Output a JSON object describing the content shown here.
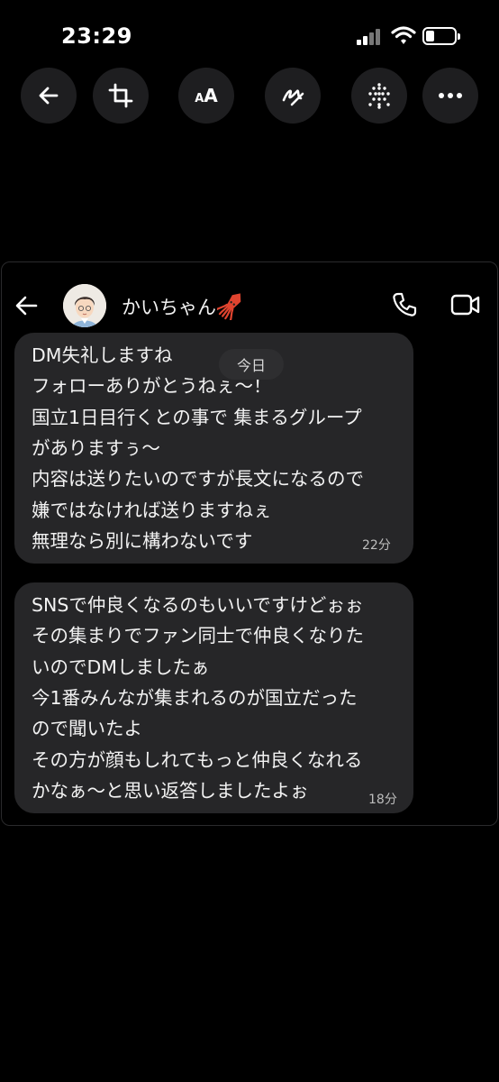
{
  "status_bar": {
    "time": "23:29",
    "battery_level": 0.3
  },
  "toolbar": {
    "items": [
      "back-icon",
      "crop-icon",
      "text-size-icon",
      "draw-icon",
      "sticker-grid-icon",
      "more-icon"
    ],
    "text_tool_label_small": "A",
    "text_tool_label_big": "A"
  },
  "chat": {
    "contact_name": "かいちゃん",
    "contact_emoji": "squid-emoji",
    "date_divider": "今日",
    "messages": [
      {
        "lines": [
          "DM失礼しますね",
          "フォローありがとうねぇ〜！",
          "国立1日目行くとの事で 集まるグループ",
          "がありますぅ〜",
          "内容は送りたいのですが長文になるので",
          "嫌ではなければ送りますねぇ",
          "無理なら別に構わないです"
        ],
        "time": "22分"
      },
      {
        "lines": [
          "SNSで仲良くなるのもいいですけどぉぉ",
          "その集まりでファン同士で仲良くなりた",
          "いのでDMしましたぁ",
          "今1番みんなが集まれるのが国立だった",
          "ので聞いたよ",
          "その方が顔もしれてもっと仲良くなれる",
          "かなぁ〜と思い返答しましたよぉ"
        ],
        "time": "18分"
      }
    ]
  },
  "colors": {
    "background": "#000000",
    "toolbar_button": "#1e1e20",
    "bubble": "#262628",
    "text": "#f2f2f2",
    "muted": "#bdbdbd"
  }
}
